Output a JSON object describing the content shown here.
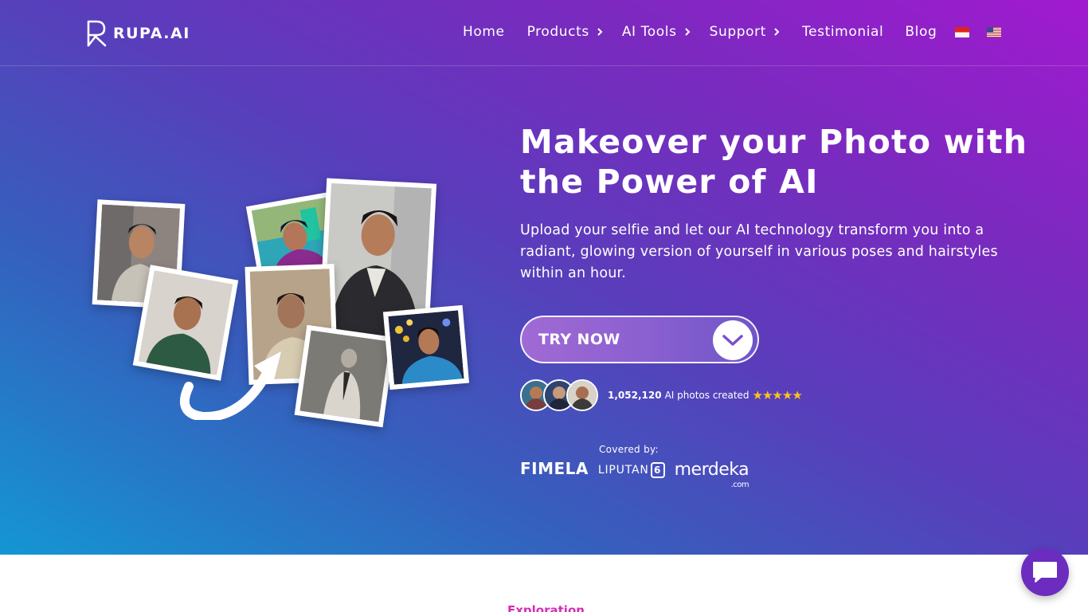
{
  "brand": {
    "name": "RUPA.AI"
  },
  "nav": {
    "items": [
      {
        "label": "Home",
        "has_dropdown": false
      },
      {
        "label": "Products",
        "has_dropdown": true
      },
      {
        "label": "AI Tools",
        "has_dropdown": true
      },
      {
        "label": "Support",
        "has_dropdown": true
      },
      {
        "label": "Testimonial",
        "has_dropdown": false
      },
      {
        "label": "Blog",
        "has_dropdown": false
      }
    ],
    "languages": [
      "indonesia-flag-icon",
      "us-flag-icon"
    ]
  },
  "hero": {
    "title": "Makeover your Photo with the Power of AI",
    "subtitle": "Upload your selfie and let our AI technology transform you into a radiant, glowing version of yourself in various poses and hairstyles within an hour.",
    "cta_label": "TRY NOW",
    "cta_icon": "chevron-down-icon",
    "stats_count": "1,052,120",
    "stats_label": "AI photos created",
    "stars": "★★★★★",
    "covered_label": "Covered by:",
    "press": [
      "FIMELA",
      "LIPUTAN",
      "merdeka",
      ".com"
    ]
  },
  "section": {
    "label": "Exploration"
  },
  "colors": {
    "accent": "#6b2cbf",
    "section_label": "#d52cb6",
    "star": "#f9c419"
  }
}
